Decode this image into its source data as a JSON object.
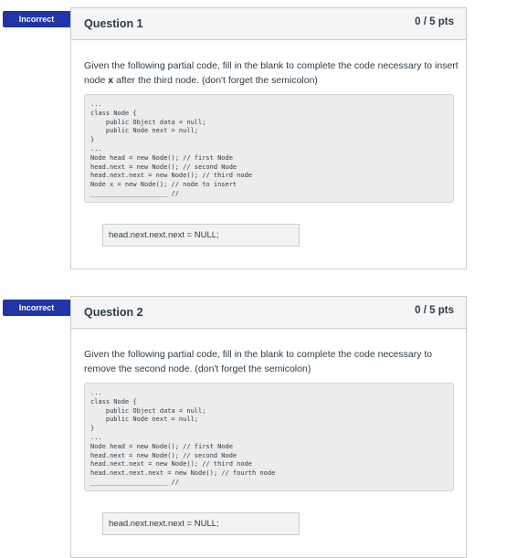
{
  "questions": [
    {
      "status": "Incorrect",
      "title": "Question 1",
      "points": "0 / 5 pts",
      "prompt_before": "Given the following partial code, fill in the blank to complete the code necessary to insert node ",
      "prompt_bold": "x",
      "prompt_after": " after the third node. (don't forget the semicolon)",
      "code_lines": [
        "...",
        "class Node {",
        "    public Object data = null;",
        "    public Node next = null;",
        "}",
        "...",
        "Node head = new Node(); // first Node",
        "head.next = new Node(); // second Node",
        "head.next.next = new Node(); // third node",
        "Node x = new Node(); // node to insert",
        "____________________ //"
      ],
      "answer": "head.next.next.next = NULL;"
    },
    {
      "status": "Incorrect",
      "title": "Question 2",
      "points": "0 / 5 pts",
      "prompt_before": "Given the following partial code, fill in the blank to complete the code necessary to remove the second node. (don't forget the semicolon)",
      "prompt_bold": "",
      "prompt_after": "",
      "code_lines": [
        "...",
        "class Node {",
        "    public Object data = null;",
        "    public Node next = null;",
        "}",
        "...",
        "Node head = new Node(); // first Node",
        "head.next = new Node(); // second Node",
        "head.next.next = new Node(); // third node",
        "head.next.next.next = new Node(); // fourth node",
        "____________________ //"
      ],
      "answer": "head.next.next.next = NULL;"
    }
  ],
  "colors": {
    "banner": "#1f35a8",
    "header_bg": "#f5f5f5",
    "border": "#c7cdd1",
    "code_bg": "#ececec",
    "text": "#2d3b45"
  }
}
